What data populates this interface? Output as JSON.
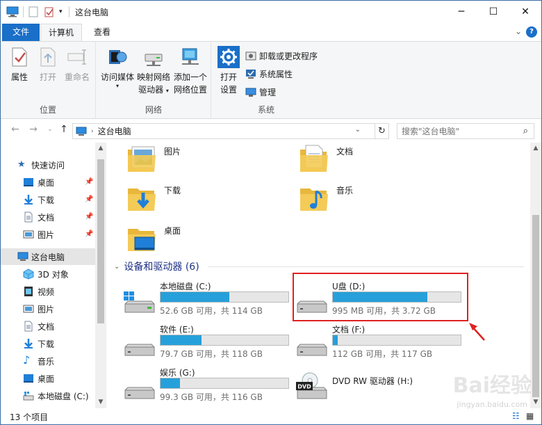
{
  "window": {
    "title": "这台电脑"
  },
  "tabs": {
    "file": "文件",
    "computer": "计算机",
    "view": "查看"
  },
  "ribbon": {
    "location": {
      "label": "位置",
      "properties": "属性",
      "open": "打开",
      "rename": "重命名"
    },
    "network": {
      "label": "网络",
      "access_media": "访问媒体",
      "map_drive_1": "映射网络",
      "map_drive_2": "驱动器",
      "add_location_1": "添加一个",
      "add_location_2": "网络位置"
    },
    "system": {
      "label": "系统",
      "open_settings_1": "打开",
      "open_settings_2": "设置",
      "uninstall": "卸载或更改程序",
      "system_properties": "系统属性",
      "manage": "管理"
    }
  },
  "nav": {
    "address_crumb": "这台电脑",
    "search_placeholder": "搜索\"这台电脑\"",
    "quick_access": "快速访问",
    "quick_items": [
      {
        "label": "桌面"
      },
      {
        "label": "下载"
      },
      {
        "label": "文档"
      },
      {
        "label": "图片"
      }
    ],
    "this_pc": "这台电脑",
    "pc_items": [
      {
        "label": "3D 对象"
      },
      {
        "label": "视频"
      },
      {
        "label": "图片"
      },
      {
        "label": "文档"
      },
      {
        "label": "下载"
      },
      {
        "label": "音乐"
      },
      {
        "label": "桌面"
      },
      {
        "label": "本地磁盘 (C:)"
      }
    ]
  },
  "folders": [
    {
      "name": "图片",
      "icon": "pictures-folder-icon"
    },
    {
      "name": "文档",
      "icon": "documents-folder-icon"
    },
    {
      "name": "下载",
      "icon": "downloads-folder-icon"
    },
    {
      "name": "音乐",
      "icon": "music-folder-icon"
    },
    {
      "name": "桌面",
      "icon": "desktop-folder-icon"
    }
  ],
  "devices_header": "设备和驱动器 (6)",
  "drives": [
    {
      "name": "本地磁盘 (C:)",
      "info": "52.6 GB 可用，共 114 GB",
      "used_fraction": 0.54
    },
    {
      "name": "U盘 (D:)",
      "info": "995 MB 可用，共 3.72 GB",
      "used_fraction": 0.74
    },
    {
      "name": "软件 (E:)",
      "info": "79.7 GB 可用，共 118 GB",
      "used_fraction": 0.32
    },
    {
      "name": "文档 (F:)",
      "info": "112 GB 可用，共 117 GB",
      "used_fraction": 0.04
    },
    {
      "name": "娱乐 (G:)",
      "info": "99.3 GB 可用，共 116 GB",
      "used_fraction": 0.15
    },
    {
      "name": "DVD RW 驱动器 (H:)",
      "info": "",
      "used_fraction": null
    }
  ],
  "status": {
    "item_count": "13 个项目"
  },
  "watermark": {
    "main": "Bai经验",
    "sub": "jingyan.baidu.com"
  },
  "colors": {
    "accent": "#1a6fc8",
    "drive_fill": "#26a0da",
    "highlight": "#e02020",
    "section_header": "#1e3287"
  }
}
